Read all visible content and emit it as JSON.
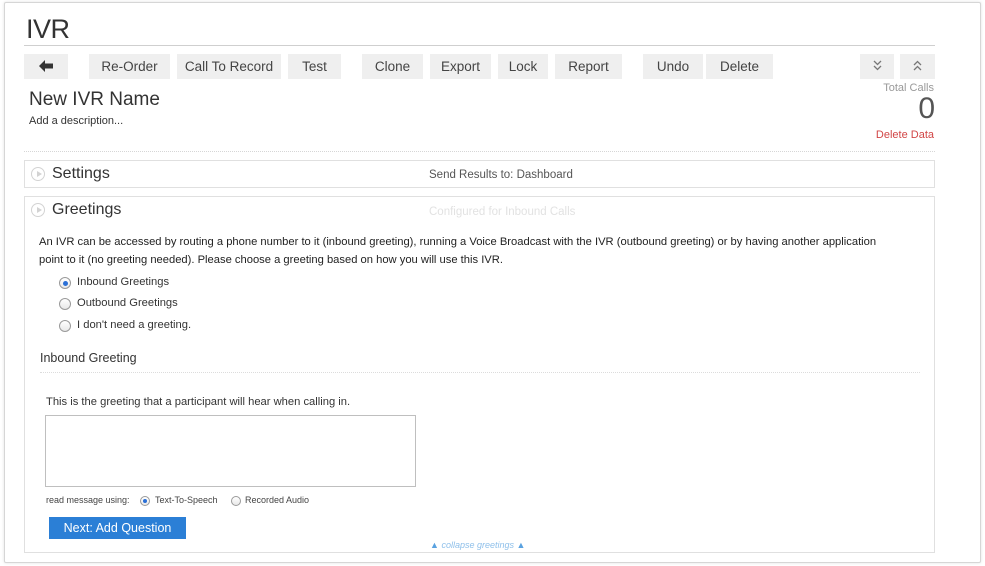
{
  "page": {
    "title": "IVR"
  },
  "toolbar": {
    "back_icon": "arrow-left-icon",
    "reorder": "Re-Order",
    "call_to_record": "Call To Record",
    "test": "Test",
    "clone": "Clone",
    "export": "Export",
    "lock": "Lock",
    "report": "Report",
    "undo": "Undo",
    "delete": "Delete",
    "expand_icon": "double-chevron-down-icon",
    "collapse_icon": "double-chevron-up-icon"
  },
  "ivr": {
    "name": "New IVR Name",
    "description_placeholder": "Add a description..."
  },
  "stats": {
    "total_calls_label": "Total Calls",
    "total_calls_value": "0",
    "delete_data": "Delete Data"
  },
  "settings_panel": {
    "title": "Settings",
    "meta": "Send Results to: Dashboard"
  },
  "greetings_panel": {
    "title": "Greetings",
    "meta": "Configured for Inbound Calls",
    "intro": "An IVR can be accessed by routing a phone number to it (inbound greeting), running a Voice Broadcast with the IVR (outbound greeting) or by having another application point to it (no greeting needed). Please choose a greeting based on how you will use this IVR.",
    "options": [
      {
        "label": "Inbound Greetings",
        "selected": true
      },
      {
        "label": "Outbound Greetings",
        "selected": false
      },
      {
        "label": "I don't need a greeting.",
        "selected": false
      }
    ],
    "section_title": "Inbound Greeting",
    "help": "This is the greeting that a participant will hear when calling in.",
    "greeting_text": "",
    "read_using_label": "read message using:",
    "read_options": [
      {
        "label": "Text-To-Speech",
        "selected": true
      },
      {
        "label": "Recorded Audio",
        "selected": false
      }
    ],
    "next_button": "Next: Add Question",
    "collapse_link": "collapse greetings"
  },
  "colors": {
    "accent": "#2b7fd6",
    "danger": "#d14545",
    "toolbar_bg": "#efefef"
  }
}
